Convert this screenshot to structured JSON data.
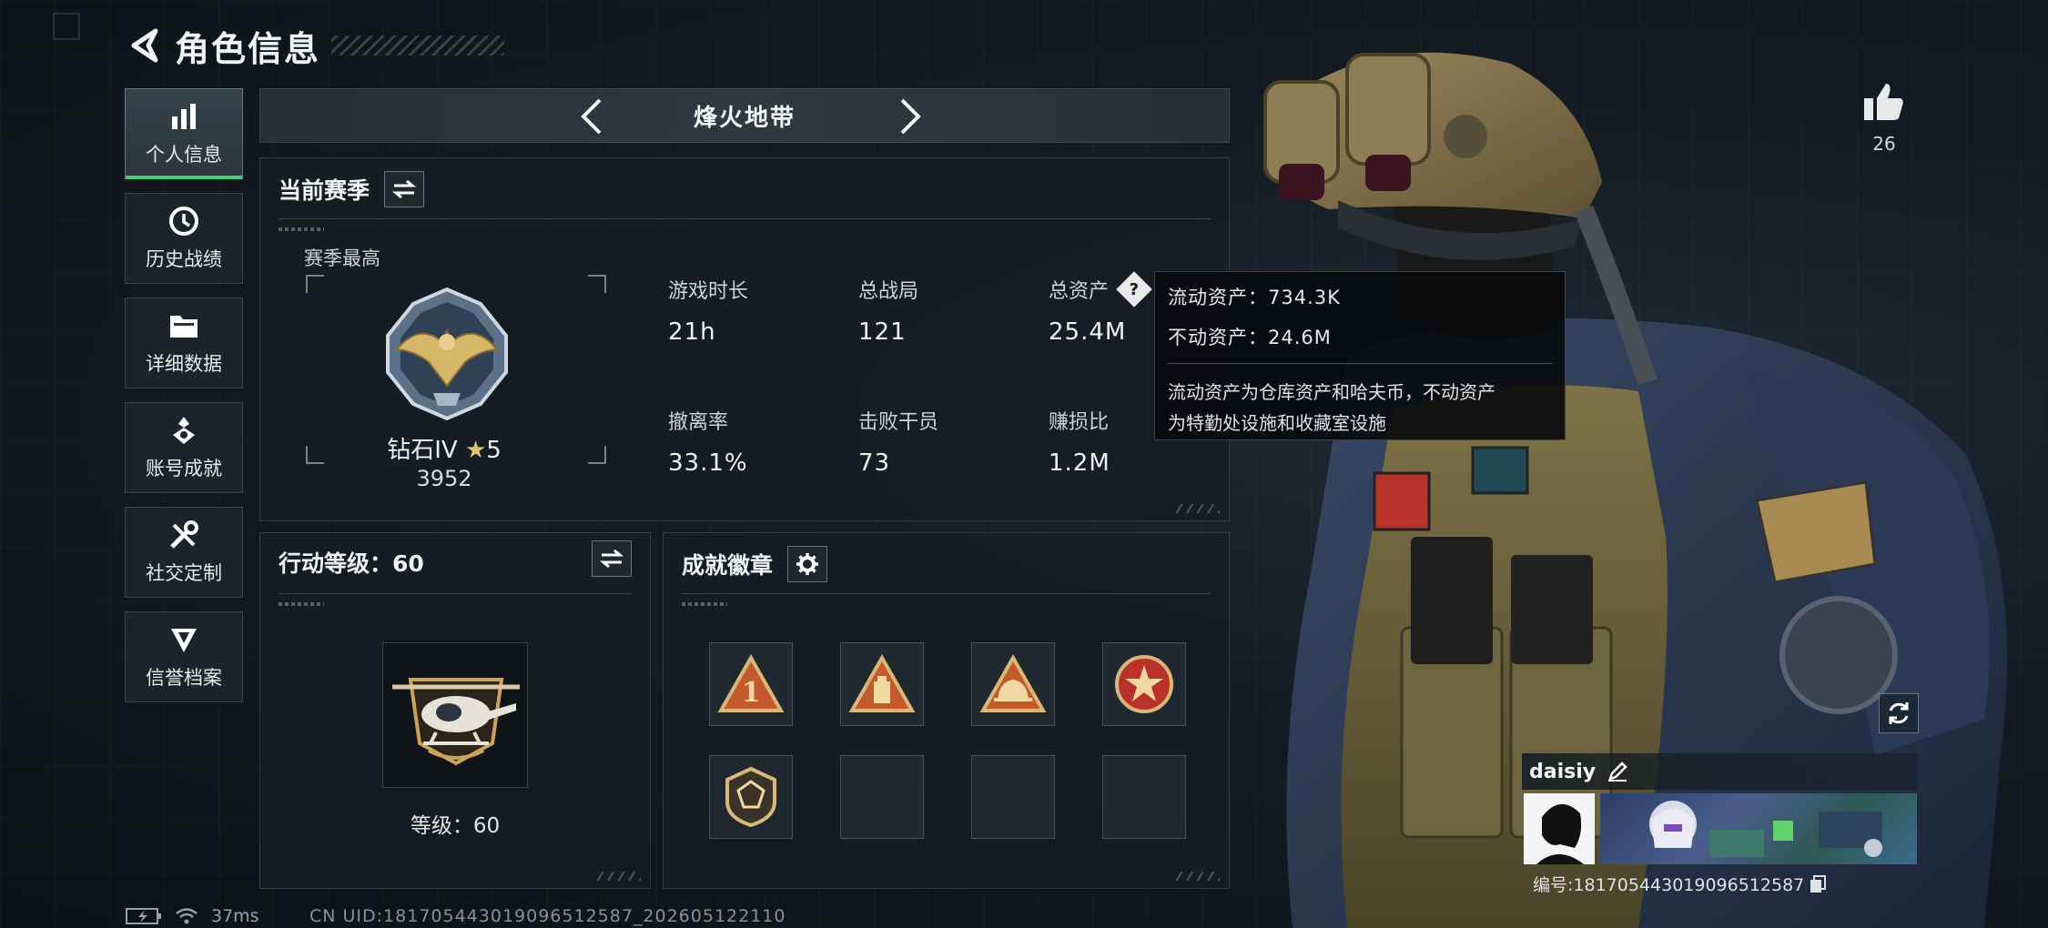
{
  "header": {
    "title": "角色信息"
  },
  "sidebar": {
    "items": [
      {
        "label": "个人信息",
        "icon": "bar-chart-icon",
        "active": true
      },
      {
        "label": "历史战绩",
        "icon": "history-icon"
      },
      {
        "label": "详细数据",
        "icon": "folder-icon"
      },
      {
        "label": "账号成就",
        "icon": "achievement-icon"
      },
      {
        "label": "社交定制",
        "icon": "tools-icon"
      },
      {
        "label": "信誉档案",
        "icon": "reputation-icon"
      }
    ]
  },
  "mode": {
    "title": "烽火地带"
  },
  "season": {
    "title": "当前赛季",
    "best_label": "赛季最高",
    "rank_name": "钻石IV",
    "rank_stars": "5",
    "rank_score": "3952",
    "stats": [
      {
        "label": "游戏时长",
        "value": "21h"
      },
      {
        "label": "总战局",
        "value": "121"
      },
      {
        "label": "总资产",
        "value": "25.4M"
      },
      {
        "label": "撤离率",
        "value": "33.1%"
      },
      {
        "label": "击败干员",
        "value": "73"
      },
      {
        "label": "赚损比",
        "value": "1.2M"
      }
    ]
  },
  "tooltip": {
    "liquid": "流动资产：734.3K",
    "fixed": "不动资产：24.6M",
    "desc_line1": "流动资产为仓库资产和哈夫币，不动资产",
    "desc_line2": "为特勤处设施和收藏室设施"
  },
  "action_level": {
    "title": "行动等级：60",
    "level_text": "等级：60"
  },
  "badges": {
    "title": "成就徽章",
    "filled_count": 5,
    "slot_count": 8
  },
  "likes": {
    "count": "26"
  },
  "player": {
    "name": "daisiy",
    "id_text": "编号:18170544301909651258​7"
  },
  "status": {
    "ping": "37ms",
    "uid": "CN UID:18170544301909651258​7_202605122110"
  },
  "colors": {
    "accent_green": "#3fd07a",
    "gold": "#c9a45a",
    "badge_red": "#b8322a"
  }
}
